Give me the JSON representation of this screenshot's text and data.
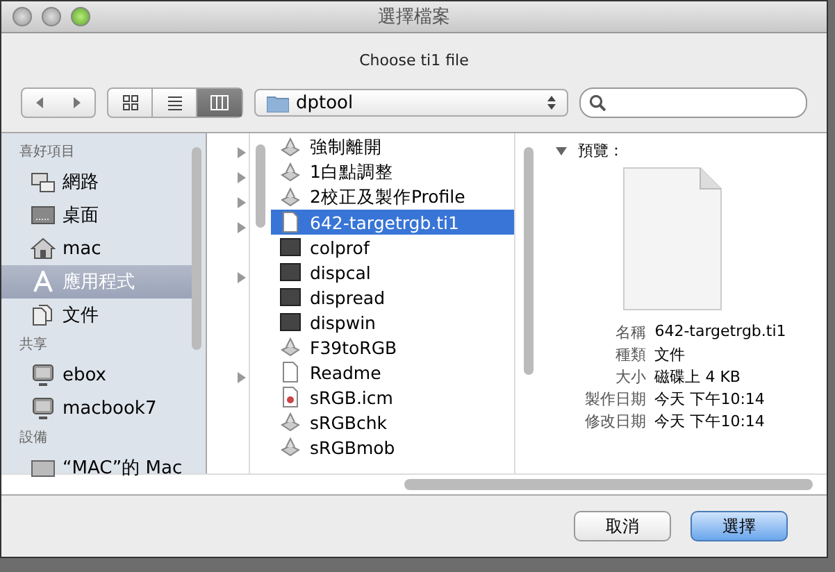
{
  "window": {
    "title": "選擇檔案"
  },
  "prompt": "Choose ti1  file",
  "toolbar": {
    "view_modes": [
      {
        "kind": "icons",
        "selected": false
      },
      {
        "kind": "list",
        "selected": false
      },
      {
        "kind": "columns",
        "selected": true
      }
    ],
    "location": "dptool"
  },
  "sidebar": {
    "sections": [
      {
        "title": "喜好項目",
        "items": [
          {
            "label": "網路",
            "kind": "network",
            "selected": false
          },
          {
            "label": "桌面",
            "kind": "desktop",
            "selected": false
          },
          {
            "label": "mac",
            "kind": "home",
            "selected": false
          },
          {
            "label": "應用程式",
            "kind": "apps",
            "selected": true
          },
          {
            "label": "文件",
            "kind": "documents",
            "selected": false
          }
        ]
      },
      {
        "title": "共享",
        "items": [
          {
            "label": "ebox",
            "kind": "computer",
            "selected": false
          },
          {
            "label": "macbook7",
            "kind": "computer",
            "selected": false
          }
        ]
      },
      {
        "title": "設備",
        "items": [
          {
            "label": "“MAC”的 Mac",
            "kind": "disk",
            "selected": false
          }
        ]
      }
    ]
  },
  "previous_column": [
    {
      "expandable": true
    },
    {
      "expandable": true
    },
    {
      "expandable": true
    },
    {
      "expandable": true
    },
    {
      "expandable": false
    },
    {
      "expandable": true
    },
    {
      "expandable": false
    },
    {
      "expandable": false
    },
    {
      "expandable": false
    },
    {
      "expandable": true
    }
  ],
  "files": [
    {
      "name": "強制離開",
      "kind": "app",
      "selected": false
    },
    {
      "name": "1白點調整",
      "kind": "app",
      "selected": false
    },
    {
      "name": "2校正及製作Profile",
      "kind": "app",
      "selected": false
    },
    {
      "name": "642-targetrgb.ti1",
      "kind": "doc",
      "selected": true
    },
    {
      "name": "colprof",
      "kind": "exec",
      "selected": false
    },
    {
      "name": "dispcal",
      "kind": "exec",
      "selected": false
    },
    {
      "name": "dispread",
      "kind": "exec",
      "selected": false
    },
    {
      "name": "dispwin",
      "kind": "exec",
      "selected": false
    },
    {
      "name": "F39toRGB",
      "kind": "app",
      "selected": false
    },
    {
      "name": "Readme",
      "kind": "doc",
      "selected": false
    },
    {
      "name": "sRGB.icm",
      "kind": "icc",
      "selected": false
    },
    {
      "name": "sRGBchk",
      "kind": "app",
      "selected": false
    },
    {
      "name": "sRGBmob",
      "kind": "app",
      "selected": false
    }
  ],
  "preview": {
    "heading": "預覽：",
    "info": [
      {
        "label": "名稱",
        "value": "642-targetrgb.ti1"
      },
      {
        "label": "種類",
        "value": "文件"
      },
      {
        "label": "大小",
        "value": "磁碟上 4 KB"
      },
      {
        "label": "製作日期",
        "value": "今天 下午10:14"
      },
      {
        "label": "修改日期",
        "value": "今天 下午10:14"
      }
    ]
  },
  "buttons": [
    {
      "label": "取消",
      "default": false
    },
    {
      "label": "選擇",
      "default": true
    }
  ]
}
